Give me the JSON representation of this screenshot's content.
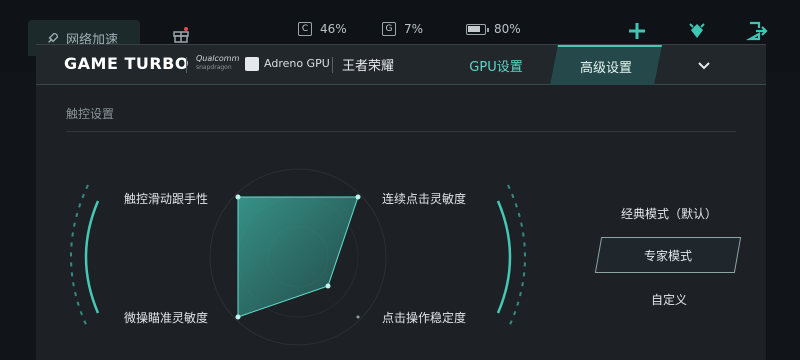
{
  "topbar": {
    "network_button": "网络加速",
    "cpu_letter": "C",
    "cpu_value": "46%",
    "gpu_letter": "G",
    "gpu_value": "7%",
    "battery_value": "80%",
    "battery_level": 0.8,
    "icons": [
      "rocket-icon",
      "gift-icon",
      "plus-icon",
      "alarm-icon",
      "exit-icon"
    ]
  },
  "header": {
    "brand": "GAME TURBO",
    "qualcomm": "Qualcomm",
    "snapdragon": "snapdragon",
    "adreno": "Adreno GPU",
    "game": "王者荣耀",
    "tab_gpu": "GPU设置",
    "tab_advanced": "高级设置"
  },
  "section": {
    "title": "触控设置"
  },
  "radar": {
    "labels": {
      "top_left": "触控滑动跟手性",
      "top_right": "连续点击灵敏度",
      "bottom_left": "微操瞄准灵敏度",
      "bottom_right": "点击操作稳定度"
    }
  },
  "modes": {
    "classic": "经典模式（默认）",
    "expert": "专家模式",
    "custom": "自定义"
  },
  "colors": {
    "accent": "#45c8b6",
    "background": "#111418",
    "panel": "#1d2126"
  }
}
